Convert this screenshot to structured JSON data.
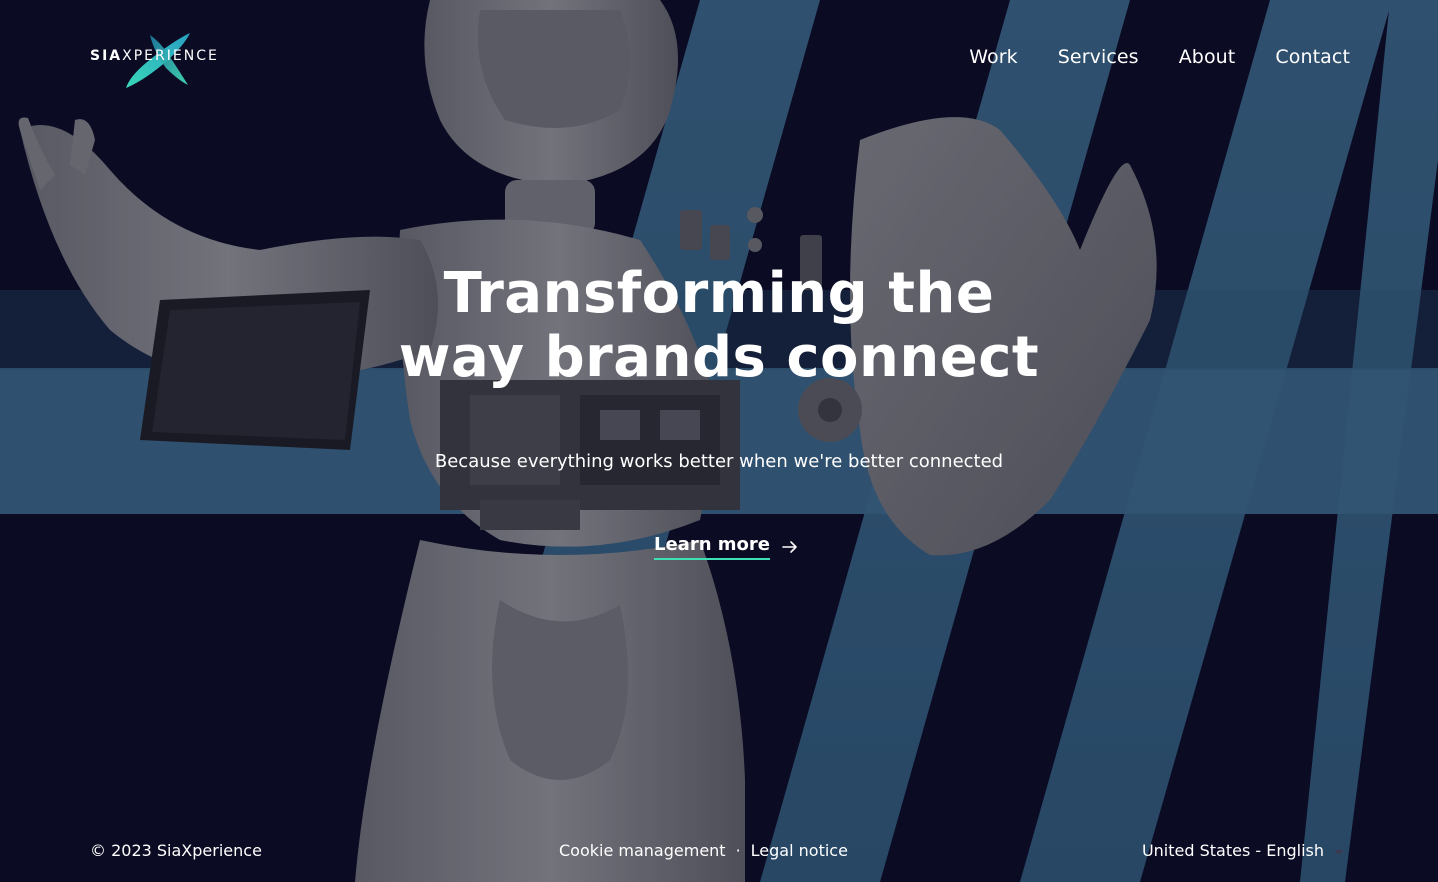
{
  "brand": {
    "logo_prefix": "SIA",
    "logo_suffix": "XPERIENCE"
  },
  "nav": {
    "items": [
      {
        "label": "Work"
      },
      {
        "label": "Services"
      },
      {
        "label": "About"
      },
      {
        "label": "Contact"
      }
    ]
  },
  "hero": {
    "title_line1": "Transforming the",
    "title_line2": "way brands connect",
    "subtitle": "Because everything works better when we're better connected",
    "cta_label": "Learn more",
    "cta_icon": "arrow-right-icon",
    "background_image": "exploded-robot-illustration"
  },
  "footer": {
    "copyright": "© 2023 SiaXperience",
    "cookie_label": "Cookie management",
    "separator": "·",
    "legal_label": "Legal notice",
    "locale_label": "United States - English",
    "locale_icon": "caret-down-icon"
  },
  "colors": {
    "background": "#0b0b24",
    "stripe": "#3a6585",
    "accent": "#3ddfb5",
    "text": "#ffffff"
  }
}
